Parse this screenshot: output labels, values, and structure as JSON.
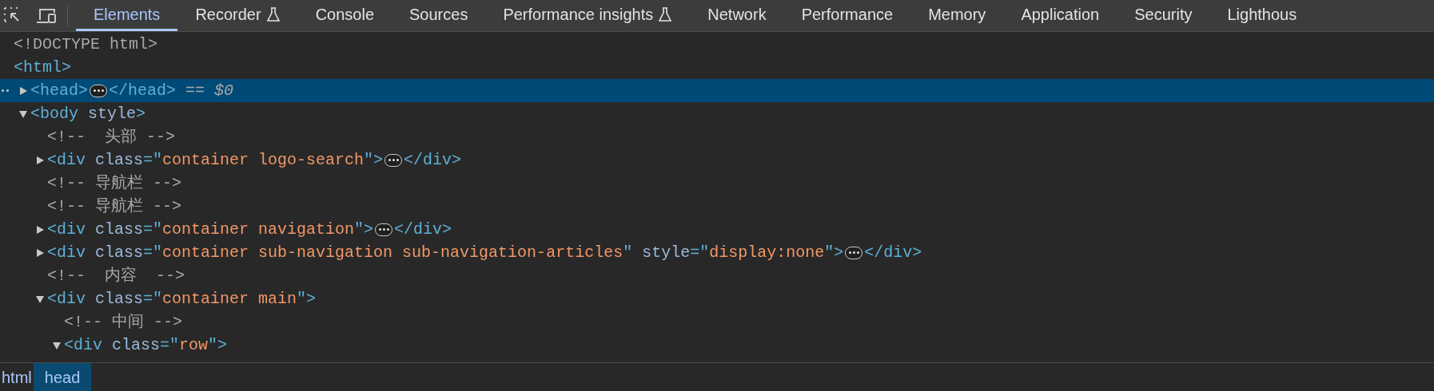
{
  "toolbar": {
    "tabs": [
      {
        "label": "Elements",
        "selected": true,
        "experimental": false
      },
      {
        "label": "Recorder",
        "selected": false,
        "experimental": true
      },
      {
        "label": "Console",
        "selected": false,
        "experimental": false
      },
      {
        "label": "Sources",
        "selected": false,
        "experimental": false
      },
      {
        "label": "Performance insights",
        "selected": false,
        "experimental": true
      },
      {
        "label": "Network",
        "selected": false,
        "experimental": false
      },
      {
        "label": "Performance",
        "selected": false,
        "experimental": false
      },
      {
        "label": "Memory",
        "selected": false,
        "experimental": false
      },
      {
        "label": "Application",
        "selected": false,
        "experimental": false
      },
      {
        "label": "Security",
        "selected": false,
        "experimental": false
      },
      {
        "label": "Lighthous",
        "selected": false,
        "experimental": false
      }
    ]
  },
  "dom_tree": [
    {
      "selected": false,
      "parts": [
        {
          "kind": "doctype",
          "text": "<!DOCTYPE html>"
        }
      ]
    },
    {
      "selected": false,
      "parts": [
        {
          "kind": "tag",
          "text": "<html>"
        }
      ],
      "children": [
        {
          "selected": true,
          "expanded": false,
          "parts": [
            {
              "kind": "tag",
              "text": "<head>"
            },
            {
              "kind": "ellipsis"
            },
            {
              "kind": "tag",
              "text": "</head>"
            },
            {
              "kind": "marker",
              "text": " == $0"
            }
          ]
        },
        {
          "selected": false,
          "expanded": true,
          "parts": [
            {
              "kind": "tag",
              "text": "<body"
            },
            {
              "kind": "attr",
              "text": " style"
            },
            {
              "kind": "tag",
              "text": ">"
            }
          ],
          "children": [
            {
              "selected": false,
              "parts": [
                {
                  "kind": "comment",
                  "text": "<!--  头部 -->"
                }
              ]
            },
            {
              "selected": false,
              "expanded": false,
              "parts": [
                {
                  "kind": "tag",
                  "text": "<div"
                },
                {
                  "kind": "attr",
                  "text": " class"
                },
                {
                  "kind": "tag",
                  "text": "=\""
                },
                {
                  "kind": "value",
                  "text": "container logo-search"
                },
                {
                  "kind": "tag",
                  "text": "\">"
                },
                {
                  "kind": "ellipsis"
                },
                {
                  "kind": "tag",
                  "text": "</div>"
                }
              ]
            },
            {
              "selected": false,
              "parts": [
                {
                  "kind": "comment",
                  "text": "<!-- 导航栏 -->"
                }
              ]
            },
            {
              "selected": false,
              "parts": [
                {
                  "kind": "comment",
                  "text": "<!-- 导航栏 -->"
                }
              ]
            },
            {
              "selected": false,
              "expanded": false,
              "parts": [
                {
                  "kind": "tag",
                  "text": "<div"
                },
                {
                  "kind": "attr",
                  "text": " class"
                },
                {
                  "kind": "tag",
                  "text": "=\""
                },
                {
                  "kind": "value",
                  "text": "container navigation"
                },
                {
                  "kind": "tag",
                  "text": "\">"
                },
                {
                  "kind": "ellipsis"
                },
                {
                  "kind": "tag",
                  "text": "</div>"
                }
              ]
            },
            {
              "selected": false,
              "expanded": false,
              "parts": [
                {
                  "kind": "tag",
                  "text": "<div"
                },
                {
                  "kind": "attr",
                  "text": " class"
                },
                {
                  "kind": "tag",
                  "text": "=\""
                },
                {
                  "kind": "value",
                  "text": "container sub-navigation sub-navigation-articles"
                },
                {
                  "kind": "tag",
                  "text": "\""
                },
                {
                  "kind": "attr",
                  "text": " style"
                },
                {
                  "kind": "tag",
                  "text": "=\""
                },
                {
                  "kind": "value",
                  "text": "display:none"
                },
                {
                  "kind": "tag",
                  "text": "\">"
                },
                {
                  "kind": "ellipsis"
                },
                {
                  "kind": "tag",
                  "text": "</div>"
                }
              ]
            },
            {
              "selected": false,
              "parts": [
                {
                  "kind": "comment",
                  "text": "<!--  内容  -->"
                }
              ]
            },
            {
              "selected": false,
              "expanded": true,
              "parts": [
                {
                  "kind": "tag",
                  "text": "<div"
                },
                {
                  "kind": "attr",
                  "text": " class"
                },
                {
                  "kind": "tag",
                  "text": "=\""
                },
                {
                  "kind": "value",
                  "text": "container main"
                },
                {
                  "kind": "tag",
                  "text": "\">"
                }
              ],
              "children": [
                {
                  "selected": false,
                  "parts": [
                    {
                      "kind": "comment",
                      "text": "<!-- 中间 -->"
                    }
                  ]
                },
                {
                  "selected": false,
                  "expanded": true,
                  "parts": [
                    {
                      "kind": "tag",
                      "text": "<div"
                    },
                    {
                      "kind": "attr",
                      "text": " class"
                    },
                    {
                      "kind": "tag",
                      "text": "=\""
                    },
                    {
                      "kind": "value",
                      "text": "row"
                    },
                    {
                      "kind": "tag",
                      "text": "\">"
                    }
                  ]
                }
              ]
            }
          ]
        }
      ]
    }
  ],
  "breadcrumbs": [
    {
      "label": "html",
      "selected": false
    },
    {
      "label": "head",
      "selected": true
    }
  ]
}
